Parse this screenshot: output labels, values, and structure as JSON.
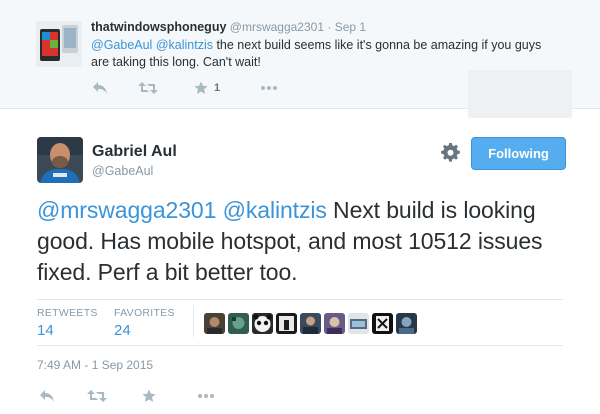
{
  "reply": {
    "name": "thatwindowsphoneguy",
    "handle": "@mrswagga2301",
    "separator": "·",
    "date": "Sep 1",
    "mention1": "@GabeAul",
    "mention2": "@kalintzis",
    "text": " the next build seems like it's gonna be amazing if you guys are taking this long. Can't wait!",
    "favorites_count": "1"
  },
  "tweet": {
    "name": "Gabriel Aul",
    "handle": "@GabeAul",
    "follow_label": "Following",
    "mention1": "@mrswagga2301",
    "mention2": "@kalintzis",
    "text": " Next build is looking good. Has mobile hotspot, and most 10512 issues fixed. Perf a bit better too.",
    "retweets_label": "RETWEETS",
    "retweets_count": "14",
    "favorites_label": "FAVORITES",
    "favorites_count": "24",
    "timestamp": "7:49 AM - 1 Sep 2015"
  },
  "icons": {
    "reply": "reply-icon",
    "retweet": "retweet-icon",
    "favorite": "star-icon",
    "more": "more-icon",
    "settings": "gear-icon"
  },
  "colors": {
    "accent": "#55acee",
    "link": "#3b94d9",
    "muted": "#8899a6",
    "text": "#292f33",
    "reply_bg": "#f5f8fa"
  }
}
